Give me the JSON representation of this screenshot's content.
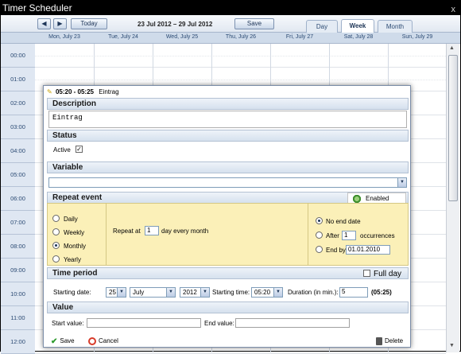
{
  "window": {
    "title": "Timer Scheduler",
    "close_glyph": "x"
  },
  "toolbar": {
    "prev_label": "◀",
    "next_label": "▶",
    "today_label": "Today",
    "date_range": "23 Jul 2012 – 29 Jul 2012",
    "save_label": "Save",
    "tabs": [
      {
        "label": "Day",
        "active": false
      },
      {
        "label": "Week",
        "active": true
      },
      {
        "label": "Month",
        "active": false
      }
    ]
  },
  "days": [
    "Mon, July 23",
    "Tue, July 24",
    "Wed, July 25",
    "Thu, July 26",
    "Fri, July 27",
    "Sat, July 28",
    "Sun, July 29"
  ],
  "hours": [
    "00:00",
    "01:00",
    "02:00",
    "03:00",
    "04:00",
    "05:00",
    "06:00",
    "07:00",
    "08:00",
    "09:00",
    "10:00",
    "11:00",
    "12:00"
  ],
  "dialog": {
    "header_time": "05:20 - 05:25",
    "header_title": "Eintrag",
    "description": {
      "title": "Description",
      "value": "Eintrag"
    },
    "status": {
      "title": "Status",
      "active_label": "Active",
      "active_checked": true
    },
    "variable": {
      "title": "Variable",
      "value": ""
    },
    "repeat": {
      "title": "Repeat event",
      "enabled_label": "Enabled",
      "modes": [
        {
          "label": "Daily",
          "selected": false
        },
        {
          "label": "Weekly",
          "selected": false
        },
        {
          "label": "Monthly",
          "selected": true
        },
        {
          "label": "Yearly",
          "selected": false
        }
      ],
      "repeat_at_prefix": "Repeat at",
      "repeat_at_value": "1",
      "repeat_at_suffix": "day every month",
      "end_options": [
        {
          "label": "No end date",
          "selected": true
        },
        {
          "label": "After",
          "selected": false
        },
        {
          "label": "End by",
          "selected": false
        }
      ],
      "after_value": "1",
      "after_suffix": "occurrences",
      "end_by_value": "01.01.2010"
    },
    "time_period": {
      "title": "Time period",
      "full_day_label": "Full day",
      "full_day_checked": false,
      "starting_date_label": "Starting date:",
      "day_value": "25",
      "month_value": "July",
      "year_value": "2012",
      "starting_time_label": "Starting time:",
      "time_value": "05:20",
      "duration_label": "Duration (in min.):",
      "duration_value": "5",
      "end_time": "(05:25)"
    },
    "value": {
      "title": "Value",
      "start_label": "Start value:",
      "start_value": "",
      "end_label": "End value:",
      "end_value": ""
    },
    "footer": {
      "save_label": "Save",
      "cancel_label": "Cancel",
      "delete_label": "Delete"
    }
  }
}
